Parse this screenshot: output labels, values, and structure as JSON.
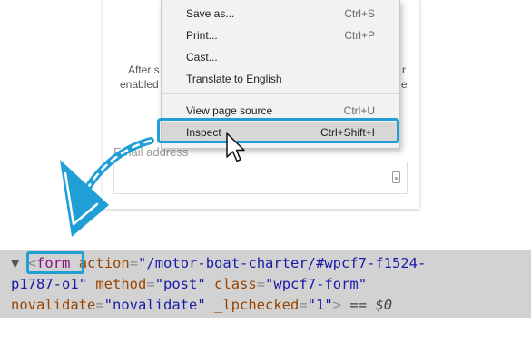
{
  "background_page": {
    "left_text_1": "After s",
    "left_text_2": "enabled",
    "right_text_1": "r",
    "right_text_2": "e",
    "field_label": "Email address"
  },
  "context_menu": {
    "items": [
      {
        "label": "Save as...",
        "shortcut": "Ctrl+S"
      },
      {
        "label": "Print...",
        "shortcut": "Ctrl+P"
      },
      {
        "label": "Cast...",
        "shortcut": ""
      },
      {
        "label": "Translate to English",
        "shortcut": ""
      },
      {
        "label": "View page source",
        "shortcut": "Ctrl+U"
      },
      {
        "label": "Inspect",
        "shortcut": "Ctrl+Shift+I"
      }
    ]
  },
  "devtools": {
    "triangle": "▼",
    "lt": "<",
    "tag": "form",
    "attr_action": "action",
    "val_action_1": "\"/motor-boat-charter/#wpcf7-f1524-",
    "val_action_2": "p1787-o1\"",
    "attr_method": "method",
    "val_method": "\"post\"",
    "attr_class": "class",
    "val_class": "\"wpcf7-form\"",
    "attr_novalidate": "novalidate",
    "val_novalidate": "\"novalidate\"",
    "attr_lpchecked": "_lpchecked",
    "val_lpchecked": "\"1\"",
    "gt": ">",
    "eq_marker": "==",
    "dollar_ref": "$0"
  },
  "colors": {
    "highlight": "#1f9fd6",
    "devtools_bg": "#d2d2d2",
    "tag_color": "#881280",
    "attr_color": "#994500",
    "value_color": "#1a1aa6"
  },
  "icons": {
    "cursor": "mouse-pointer-icon",
    "arrow": "curved-arrow-icon",
    "autofill": "autofill-key-icon"
  }
}
